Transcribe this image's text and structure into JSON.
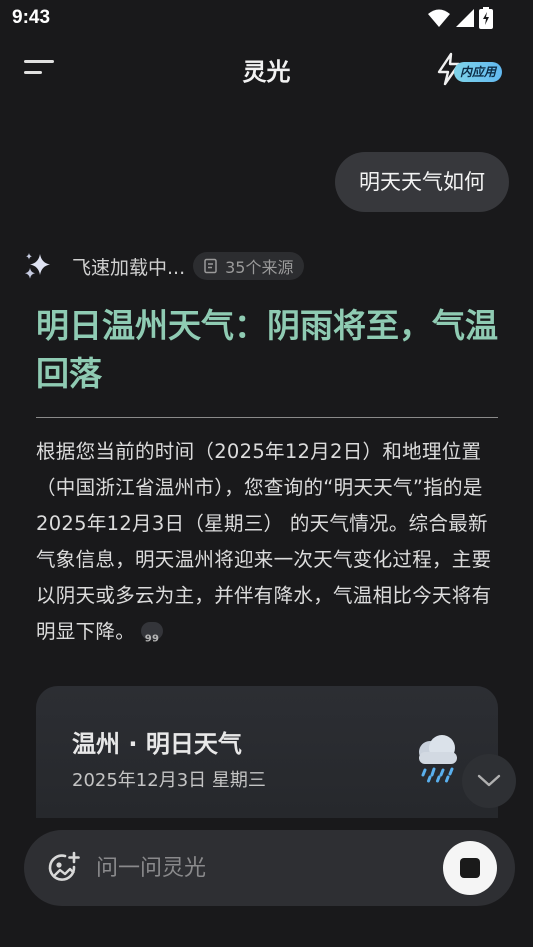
{
  "status_bar": {
    "time": "9:43"
  },
  "header": {
    "title": "灵光",
    "mini_app_badge": "内应用"
  },
  "chat": {
    "user_message": "明天天气如何",
    "loading_text": "飞速加载中...",
    "sources_label": "35个来源",
    "headline": "明日温州天气：阴雨将至，气温回落",
    "answer": "根据您当前的时间（2025年12月2日）和地理位置（中国浙江省温州市），您查询的“明天天气”指的是 2025年12月3日（星期三） 的天气情况。综合最新气象信息，明天温州将迎来一次天气变化过程，主要以阴天或多云为主，并伴有降水，气温相比今天将有明显下降。",
    "cite_mark": "99"
  },
  "weather_card": {
    "title": "温州 · 明日天气",
    "date": "2025年12月3日 星期三",
    "icon": "rain-cloud-icon"
  },
  "input": {
    "placeholder": "问一问灵光",
    "value": ""
  },
  "colors": {
    "background": "#19191b",
    "headline": "#8fcbb3",
    "bubble": "#37383c"
  }
}
